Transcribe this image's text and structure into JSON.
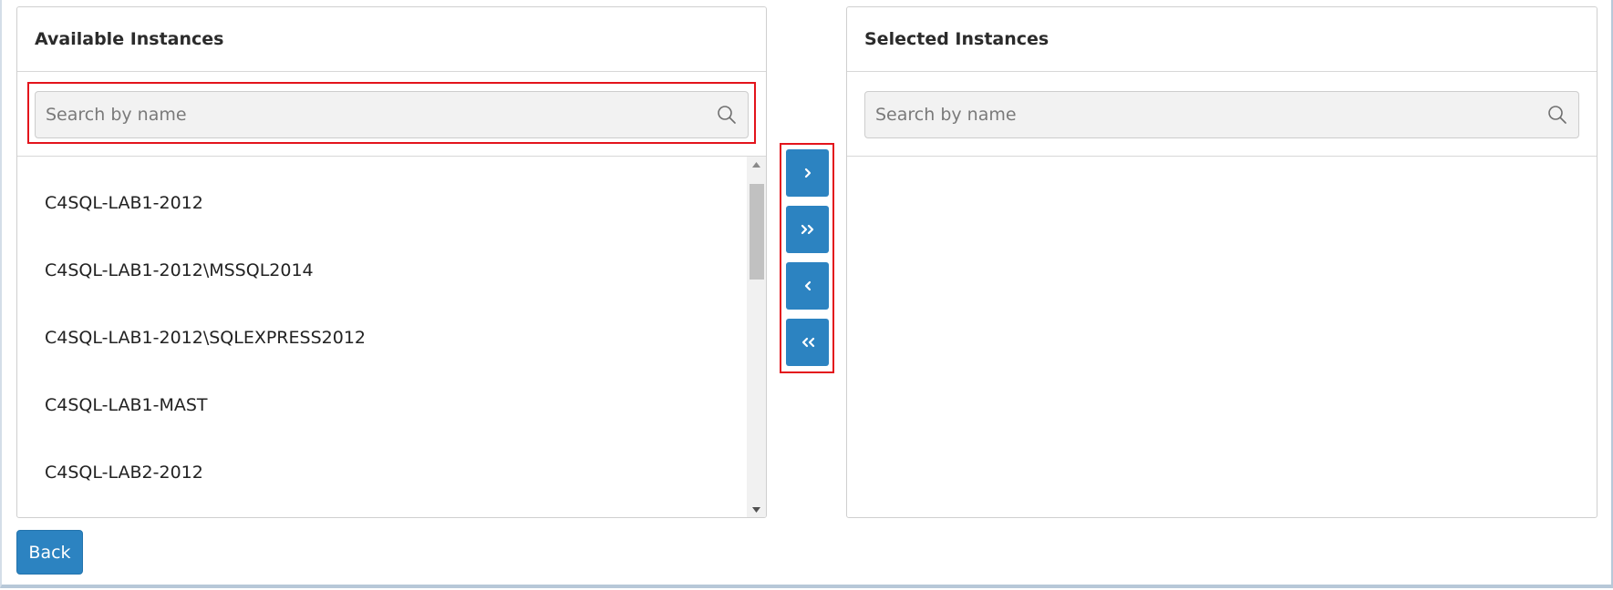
{
  "available": {
    "title": "Available Instances",
    "search_placeholder": "Search by name",
    "items": [
      "C4SQL-LAB1-2012",
      "C4SQL-LAB1-2012\\MSSQL2014",
      "C4SQL-LAB1-2012\\SQLEXPRESS2012",
      "C4SQL-LAB1-MAST",
      "C4SQL-LAB2-2012"
    ]
  },
  "selected": {
    "title": "Selected Instances",
    "search_placeholder": "Search by name",
    "items": []
  },
  "move_buttons": [
    {
      "name": "move-selected-right-button",
      "glyph": "chevron-right-icon"
    },
    {
      "name": "move-all-right-button",
      "glyph": "double-chevron-right-icon"
    },
    {
      "name": "move-selected-left-button",
      "glyph": "chevron-left-icon"
    },
    {
      "name": "move-all-left-button",
      "glyph": "double-chevron-left-icon"
    }
  ],
  "footer": {
    "back_label": "Back"
  },
  "colors": {
    "primary_button": "#2c83c1",
    "highlight_border": "#e3141c"
  }
}
